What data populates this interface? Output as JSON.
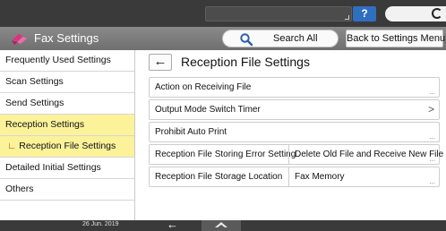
{
  "titlebar": {
    "app_title": "Fax Settings",
    "search_label": "Search All",
    "back_label": "Back to Settings Menu"
  },
  "statusbar": {
    "help_label": "?"
  },
  "sidebar": {
    "items": [
      {
        "label": "Frequently Used Settings"
      },
      {
        "label": "Scan Settings"
      },
      {
        "label": "Send Settings"
      },
      {
        "label": "Reception Settings"
      },
      {
        "label": "Reception File Settings"
      },
      {
        "label": "Detailed Initial Settings"
      },
      {
        "label": "Others"
      }
    ]
  },
  "main": {
    "title": "Reception File Settings",
    "rows": [
      {
        "label": "Action on Receiving File",
        "indicator": "..."
      },
      {
        "label": "Output Mode Switch Timer",
        "indicator": ">"
      },
      {
        "label": "Prohibit Auto Print",
        "indicator": "..."
      },
      {
        "label": "Reception File Storing Error Setting",
        "value": "Delete Old File and Receive New File",
        "indicator": "..."
      },
      {
        "label": "Reception File Storage Location",
        "value": "Fax Memory",
        "indicator": "..."
      }
    ]
  },
  "bottombar": {
    "date": "26 Jun. 2019"
  },
  "colors": {
    "selected_bg": "#fbf29a",
    "titlebar_bg": "#7c7c7c",
    "statusbar_bg": "#3a3a3a",
    "help_bg": "#2f6fbf",
    "brand_pink": "#e0307f"
  },
  "icons": {
    "app": "fax-app-icon",
    "search": "search-icon",
    "back": "back-arrow-icon",
    "help": "help-icon",
    "energy": "energy-saver-icon",
    "home": "home-icon"
  }
}
